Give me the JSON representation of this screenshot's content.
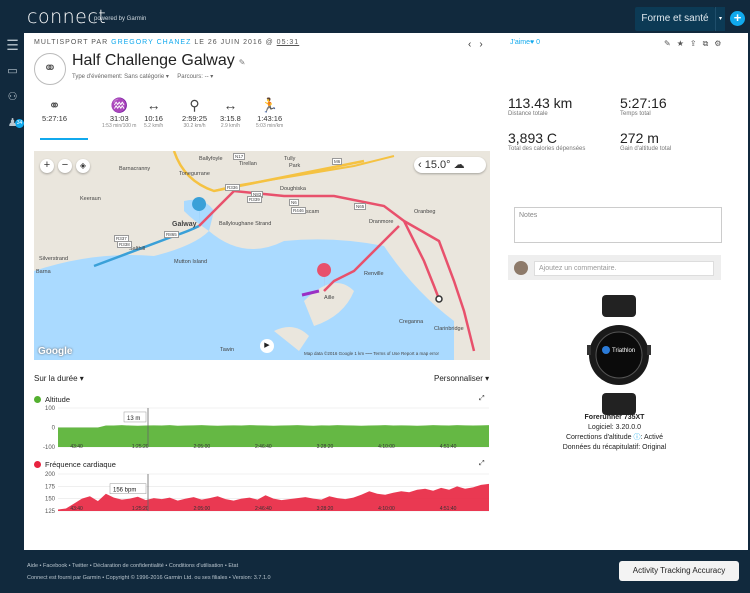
{
  "app": {
    "logo": "connect",
    "logo_sub": "powered by Garmin"
  },
  "header": {
    "workspace": "Forme et santé",
    "nav_badge": "34"
  },
  "activity": {
    "meta_prefix": "MULTISPORT PAR",
    "user": "GREGORY CHANEZ",
    "meta_date": "LE 26 JUIN 2016 @",
    "time": "05:31",
    "title": "Half Challenge Galway",
    "event_type": "Type d'événement: Sans catégorie ▾",
    "route": "Parcours: -- ▾",
    "like": "J'aime♥ 0",
    "sport_icon_label": "multisport"
  },
  "tabs": [
    {
      "icon": "multisport-icon",
      "glyph": "⚭",
      "value": "5:27:16",
      "sub": ""
    },
    {
      "icon": "swim-icon",
      "glyph": "♒",
      "value": "31:03",
      "sub": "1:53 min/100 m"
    },
    {
      "icon": "transition-icon",
      "glyph": "↔",
      "value": "10:16",
      "sub": "5.2 km/h"
    },
    {
      "icon": "bike-icon",
      "glyph": "⚲",
      "value": "2:59:25",
      "sub": "30.2 km/h"
    },
    {
      "icon": "transition-icon",
      "glyph": "↔",
      "value": "3:15.8",
      "sub": "2.9 km/h"
    },
    {
      "icon": "run-icon",
      "glyph": "🏃",
      "value": "1:43:16",
      "sub": "5:03 min/km"
    }
  ],
  "map": {
    "temp": "15.0°",
    "labels": [
      "Ballyfoyle",
      "Barnacranny",
      "Tonegurrane",
      "Tully",
      "Tirellan",
      "Park",
      "Keeraun",
      "Doughiska",
      "Roscam",
      "Oranbeg",
      "Galway",
      "Ballyloughane Strand",
      "Silverstrand",
      "Salthill",
      "Mutton Island",
      "Dranmore",
      "Renville",
      "Barna",
      "Aille",
      "Creganna",
      "Clarinbridge",
      "Tawin"
    ],
    "roads": [
      "R336",
      "N17",
      "N83",
      "R339",
      "N6",
      "R446",
      "N65",
      "R865",
      "R337",
      "R338",
      "M6"
    ],
    "attribution": "Map data ©2016 Google   1 km ⎯⎯⎯   Terms of Use   Report a map error",
    "google": "Google"
  },
  "chart_controls": {
    "range": "Sur la durée ▾",
    "customize": "Personnaliser ▾"
  },
  "chart_data": [
    {
      "type": "area",
      "title": "Altitude",
      "color": "#54b030",
      "ylim": [
        -100,
        100
      ],
      "yticks": [
        "100",
        "0",
        "-100"
      ],
      "x_ticks": [
        "43:40",
        "1:25:20",
        "2:05:00",
        "2:46:40",
        "3:28:20",
        "4:10:00",
        "4:51:40"
      ],
      "tooltip": "13 m",
      "values": [
        0,
        0,
        0,
        0,
        0,
        0,
        10,
        10,
        12,
        10,
        9,
        10,
        11,
        10,
        12,
        9,
        10,
        11,
        12,
        10,
        9,
        10,
        11,
        10,
        12,
        11,
        10,
        9,
        10,
        11,
        12,
        10,
        9,
        11,
        10,
        12,
        11,
        10,
        9,
        10,
        11,
        12,
        10,
        11,
        10,
        9,
        10,
        12,
        11,
        10,
        12,
        11,
        10,
        11,
        12
      ]
    },
    {
      "type": "area",
      "title": "Fréquence cardiaque",
      "color": "#e8233f",
      "ylim": [
        125,
        200
      ],
      "yticks": [
        "200",
        "175",
        "150",
        "125"
      ],
      "x_ticks": [
        "43:40",
        "1:25:20",
        "2:05:00",
        "2:46:40",
        "3:28:20",
        "4:10:00",
        "4:51:40"
      ],
      "tooltip": "156 bpm",
      "values": [
        128,
        130,
        140,
        150,
        155,
        145,
        160,
        152,
        148,
        150,
        154,
        147,
        151,
        149,
        152,
        146,
        150,
        153,
        148,
        151,
        155,
        149,
        146,
        150,
        152,
        148,
        157,
        150,
        147,
        149,
        151,
        153,
        150,
        148,
        155,
        151,
        149,
        152,
        158,
        165,
        160,
        158,
        162,
        165,
        163,
        168,
        170,
        166,
        172,
        168,
        175,
        170,
        173,
        178,
        180
      ]
    }
  ],
  "stats": [
    {
      "value": "113.43 km",
      "label": "Distance totale"
    },
    {
      "value": "5:27:16",
      "label": "Temps total"
    },
    {
      "value": "3,893 C",
      "label": "Total des calories dépensées"
    },
    {
      "value": "272 m",
      "label": "Gain d'altitude total"
    }
  ],
  "notes": {
    "placeholder": "Notes",
    "comment_placeholder": "Ajoutez un commentaire."
  },
  "device": {
    "name": "Forerunner 735XT",
    "software": "Logiciel: 3.20.0.0",
    "altitude_correction": "Corrections d'altitude",
    "altitude_status": ": Activé",
    "summary": "Données du récapitulatif: Original",
    "screen_text": "Triathlon"
  },
  "footer": {
    "links": "Aide • Facebook • Twitter • Déclaration de confidentialité • Conditions d'utilisation • Etat",
    "copyright": "Connect est fourni par Garmin • Copyright © 1996-2016 Garmin Ltd. ou ses filiales • Version: 3.7.1.0",
    "ata_button": "Activity Tracking Accuracy"
  }
}
